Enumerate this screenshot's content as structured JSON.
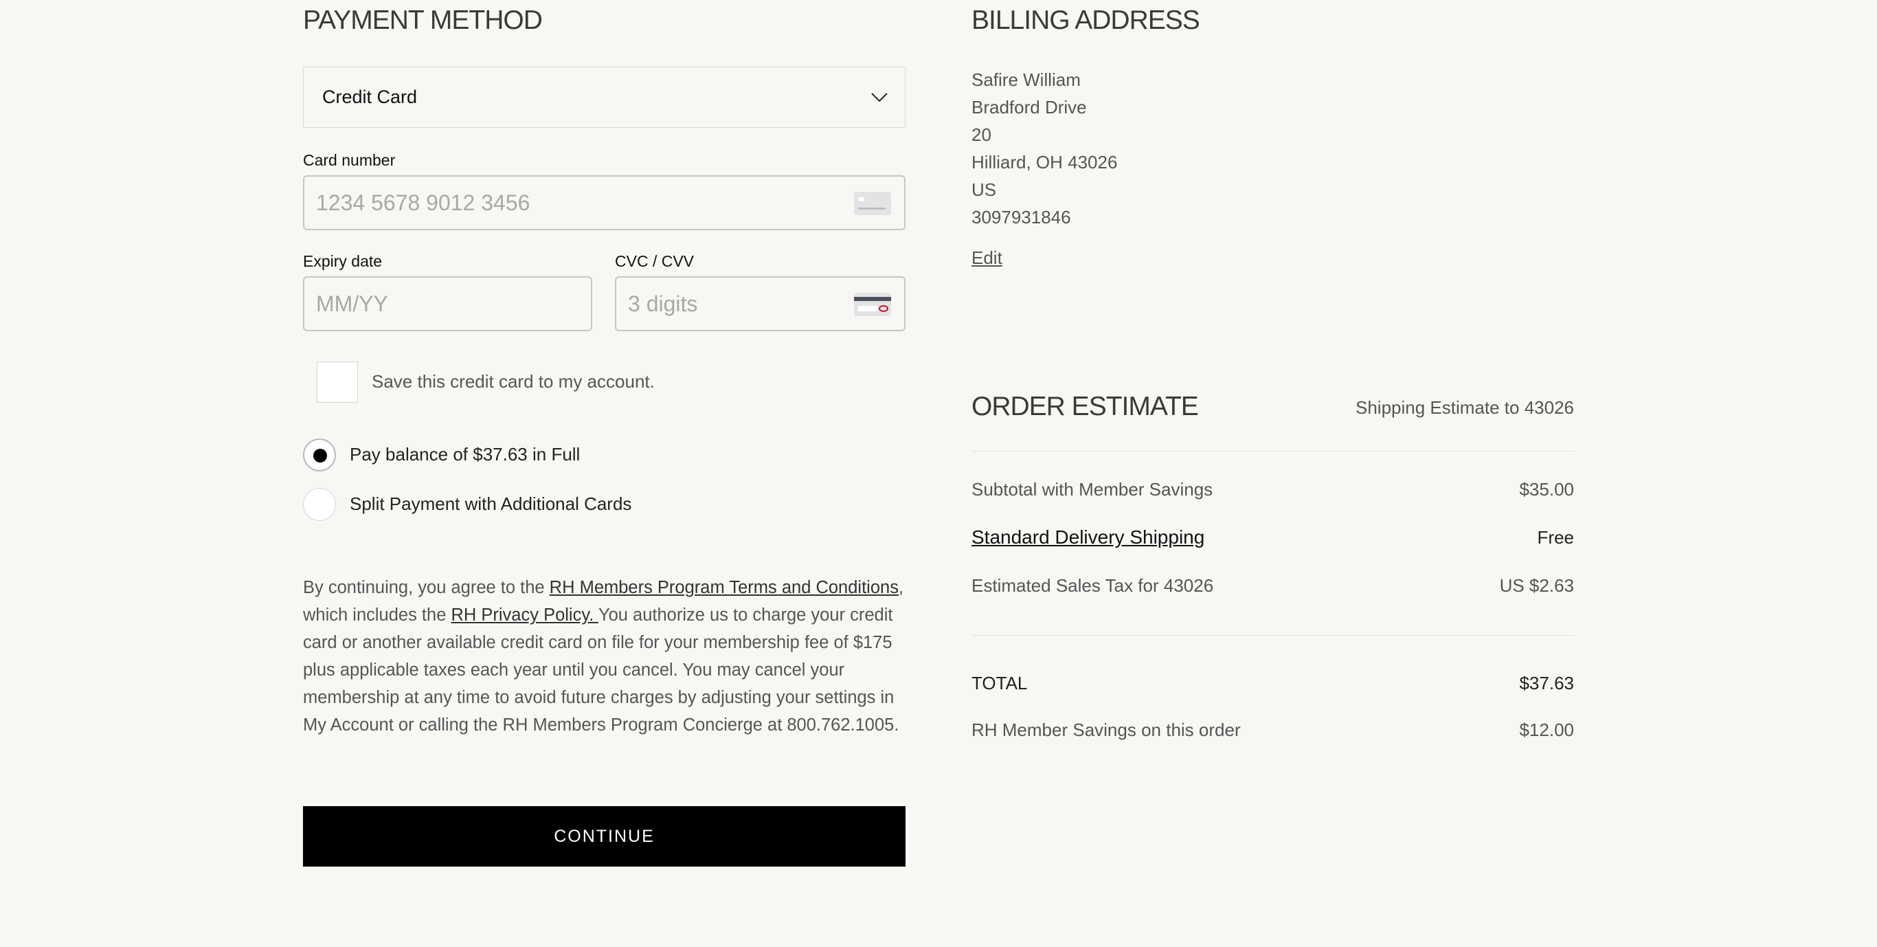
{
  "payment": {
    "title": "PAYMENT METHOD",
    "method_selected": "Credit Card",
    "card_number_label": "Card number",
    "card_number_placeholder": "1234 5678 9012 3456",
    "expiry_label": "Expiry date",
    "expiry_placeholder": "MM/YY",
    "cvc_label": "CVC / CVV",
    "cvc_placeholder": "3 digits",
    "save_card_label": "Save this credit card to my account.",
    "save_card_checked": false,
    "radio_full_label": "Pay balance of $37.63 in Full",
    "radio_split_label": "Split Payment with Additional Cards",
    "selected_option": "full"
  },
  "legal": {
    "prefix": "By continuing, you agree to the ",
    "terms_link": "RH Members Program Terms and Conditions",
    "mid": ", which includes the ",
    "privacy_link": "RH Privacy Policy. ",
    "suffix": "You authorize us to charge your credit card or another available credit card on file for your membership fee of $175 plus applicable taxes each year until you cancel. You may cancel your membership at any time to avoid future charges by adjusting your settings in My Account or calling the RH Members Program Concierge at 800.762.1005."
  },
  "continue_label": "CONTINUE",
  "billing": {
    "title": "BILLING ADDRESS",
    "lines": [
      "Safire William",
      "Bradford Drive",
      "20",
      "Hilliard, OH 43026",
      "US",
      "3097931846"
    ],
    "edit_label": "Edit"
  },
  "order": {
    "title": "ORDER ESTIMATE",
    "shipping_estimate": "Shipping Estimate to 43026",
    "subtotal_label": "Subtotal with Member Savings",
    "subtotal_value": "$35.00",
    "shipping_label": "Standard Delivery Shipping",
    "shipping_value": "Free",
    "tax_label": "Estimated Sales Tax for 43026",
    "tax_value": "US $2.63",
    "total_label": "TOTAL",
    "total_value": "$37.63",
    "savings_label": "RH Member Savings on this order",
    "savings_value": "$12.00"
  },
  "colors": {
    "background": "#f8f7f4",
    "button": "#000000",
    "accent_card_red": "#c8102e"
  }
}
